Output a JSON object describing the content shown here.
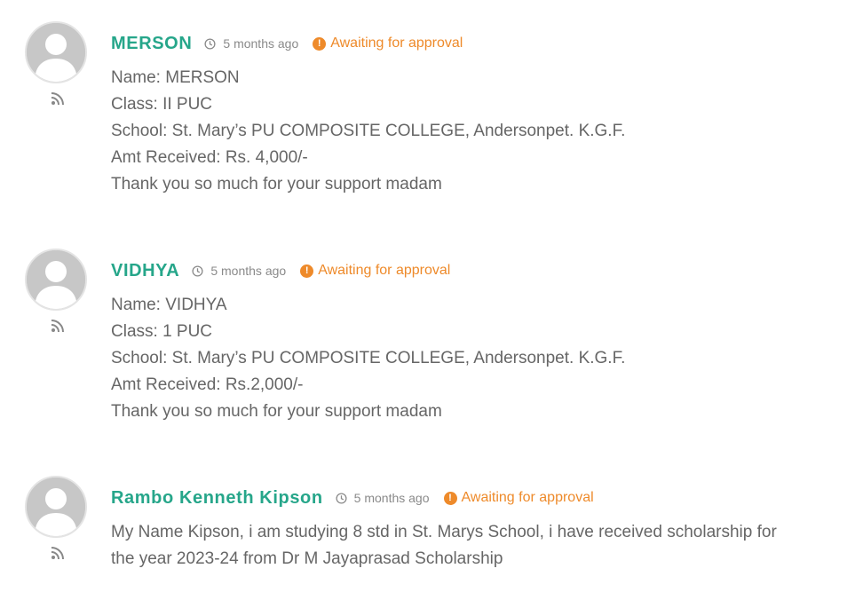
{
  "comments": [
    {
      "author": "MERSON",
      "time": "5 months ago",
      "status": "Awaiting for approval",
      "lines": [
        "Name: MERSON",
        "Class: II PUC",
        "School: St. Mary’s PU COMPOSITE COLLEGE, Andersonpet. K.G.F.",
        "Amt Received: Rs. 4,000/-",
        "Thank you so much for your support madam"
      ]
    },
    {
      "author": "VIDHYA",
      "time": "5 months ago",
      "status": "Awaiting for approval",
      "lines": [
        "Name: VIDHYA",
        "Class: 1 PUC",
        "School: St. Mary’s PU COMPOSITE COLLEGE, Andersonpet. K.G.F.",
        "Amt Received: Rs.2,000/-",
        "Thank you so much for your support madam"
      ]
    },
    {
      "author": "Rambo Kenneth Kipson",
      "time": "5 months ago",
      "status": "Awaiting for approval",
      "lines": [
        "My Name Kipson, i am studying 8 std in St. Marys School, i have received scholarship for",
        "the year 2023-24 from Dr M Jayaprasad Scholarship"
      ]
    }
  ],
  "icons": {
    "avatar": "default-avatar-icon",
    "feed": "rss-icon",
    "time": "clock-icon",
    "status": "warning-icon"
  },
  "colors": {
    "author": "#26a68a",
    "status": "#ee8a2a",
    "text": "#666666",
    "meta": "#8a8a8a"
  }
}
